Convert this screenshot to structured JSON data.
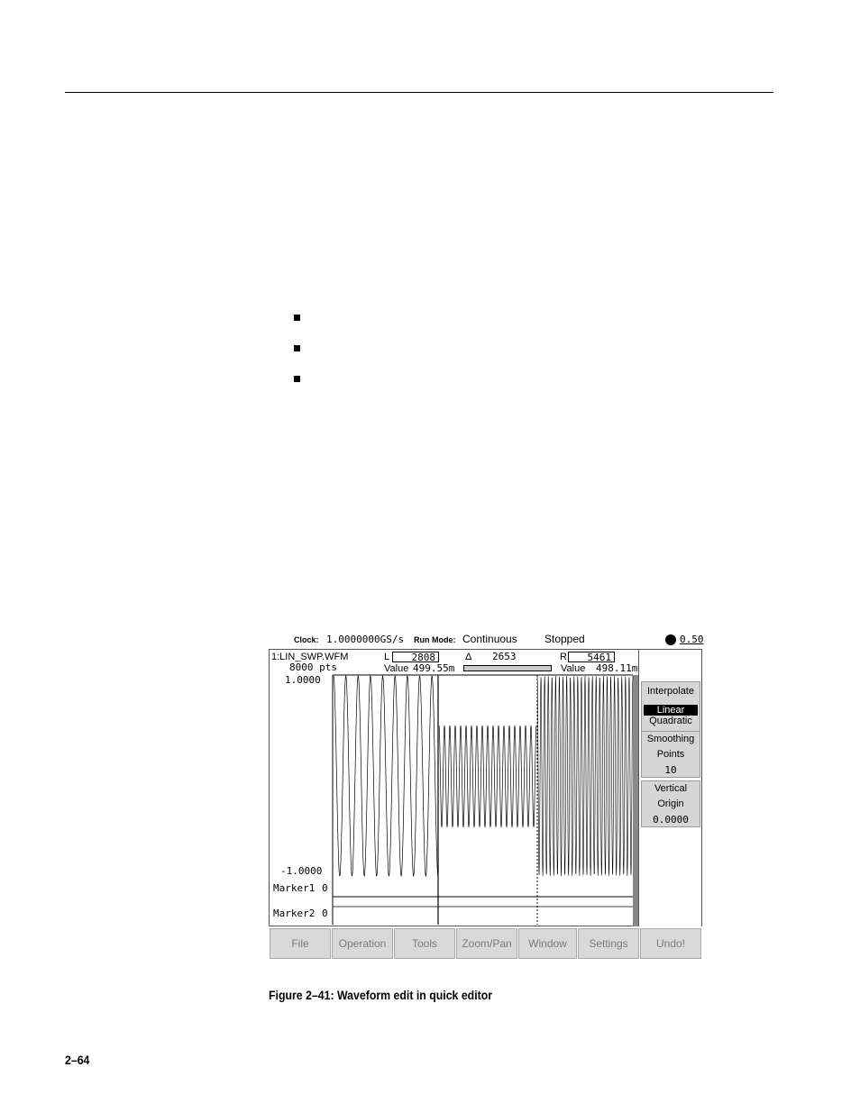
{
  "screen": {
    "clock_label": "Clock:",
    "clock_value": "1.0000000GS/s",
    "runmode_label": "Run Mode:",
    "runmode_value": "Continuous",
    "status": "Stopped",
    "level_value": "0.50",
    "waveform_name": "1:LIN_SWP.WFM",
    "points": "8000 pts",
    "left_cursor_label": "L",
    "left_cursor_value": "2808",
    "delta_label": "Δ",
    "delta_value": "2653",
    "right_cursor_label": "R",
    "right_cursor_value": "5461",
    "left_value_label": "Value",
    "left_value": "499.55m",
    "right_value_label": "Value",
    "right_value": "498.11m",
    "y_max": "1.0000",
    "y_min": "-1.0000",
    "marker1_label": "Marker1",
    "marker1_value": "0",
    "marker2_label": "Marker2",
    "marker2_value": "0",
    "side_menu": {
      "interpolate_title": "Interpolate",
      "interpolate_selected": "Linear",
      "interpolate_other": "Quadratic",
      "smoothing_line1": "Smoothing",
      "smoothing_line2": "Points",
      "smoothing_value": "10",
      "vertical_line1": "Vertical",
      "vertical_line2": "Origin",
      "vertical_value": "0.0000"
    },
    "bottom_menu": [
      "File",
      "Operation",
      "Tools",
      "Zoom/Pan",
      "Window",
      "Settings",
      "Undo!"
    ]
  },
  "caption": "Figure 2–41: Waveform edit in quick editor",
  "page_number": "2–64"
}
